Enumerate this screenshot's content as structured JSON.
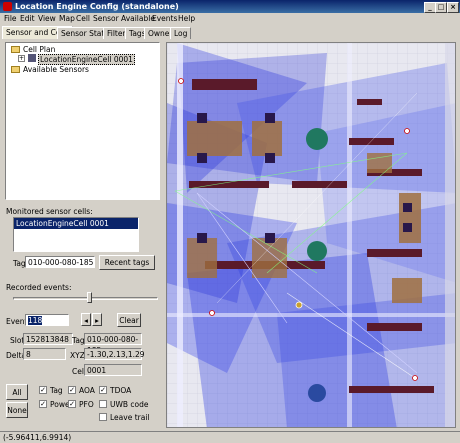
{
  "window": {
    "title": "Location Engine Config (standalone)"
  },
  "menu": [
    "File",
    "Edit",
    "View",
    "Map",
    "Cell",
    "Sensor",
    "Available",
    "Events",
    "Help"
  ],
  "tabs": [
    "Sensor and Cells",
    "Sensor Status",
    "Filters",
    "Tags",
    "Owners",
    "Log"
  ],
  "tree": {
    "root": "Cell Plan",
    "child": "LocationEngineCell 0001",
    "available": "Available Sensors"
  },
  "monitored": {
    "label": "Monitored sensor cells:",
    "items": [
      "LocationEngineCell 0001"
    ]
  },
  "tag": {
    "label": "Tag",
    "value": "010-000-080-185",
    "button": "Recent tags"
  },
  "recorded": {
    "label": "Recorded events:"
  },
  "event": {
    "label": "Event",
    "value": "118",
    "clear": "Clear"
  },
  "slot": {
    "label": "Slot",
    "value": "152813848"
  },
  "tag2": {
    "label": "Tag",
    "value": "010-000-080-185"
  },
  "delta": {
    "label": "Delta",
    "value": "8"
  },
  "xyz": {
    "label": "XYZ",
    "value": "-1.30,2.13,1.29"
  },
  "cell": {
    "label": "Cell",
    "value": "0001"
  },
  "buttons": {
    "all": "All",
    "none": "None"
  },
  "checks": {
    "tag": "Tag",
    "aoa": "AOA",
    "tdoa": "TDOA",
    "power": "Power",
    "pfo": "PFO",
    "uwb": "UWB code",
    "trail": "Leave trail"
  },
  "status": "(-5.96411,6.9914)"
}
